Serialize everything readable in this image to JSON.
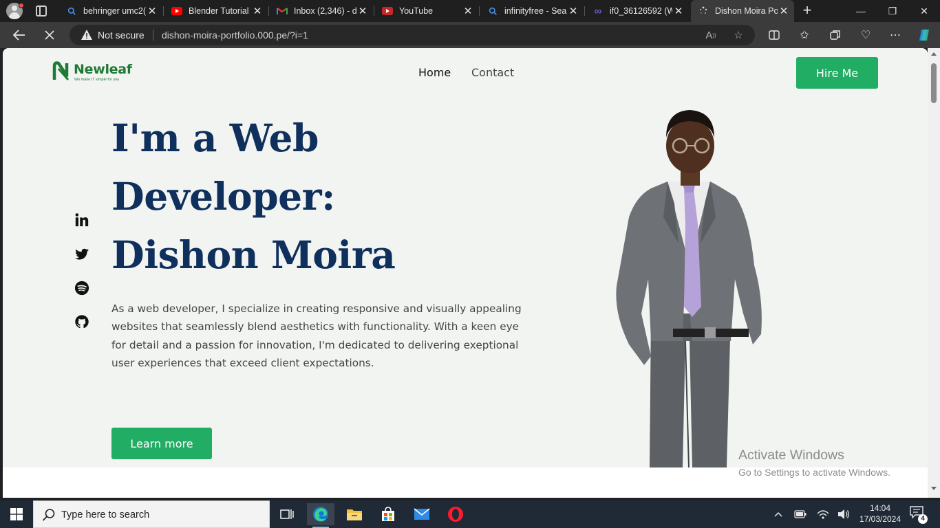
{
  "browser": {
    "tabs": [
      {
        "label": "behringer umc2(",
        "icon": "search-icon"
      },
      {
        "label": "Blender Tutorial",
        "icon": "youtube-icon"
      },
      {
        "label": "Inbox (2,346) - d",
        "icon": "gmail-icon"
      },
      {
        "label": "YouTube",
        "icon": "youtube-icon"
      },
      {
        "label": "infinityfree - Sea",
        "icon": "search-icon"
      },
      {
        "label": "if0_36126592 (W",
        "icon": "infinityfree-icon"
      },
      {
        "label": "Dishon Moira Po",
        "icon": "loading-icon",
        "active": true
      }
    ],
    "security_text": "Not secure",
    "url": "dishon-moira-portfolio.000.pe/?i=1"
  },
  "site": {
    "logo": {
      "name": "Newleaf",
      "tagline": "We make IT simple for you"
    },
    "nav": {
      "home": "Home",
      "contact": "Contact"
    },
    "hire_button": "Hire Me",
    "hero": {
      "title_lines": [
        "I'm a Web",
        "Developer:",
        "Dishon Moira"
      ],
      "description": "As a web developer, I specialize in creating responsive and visually appealing websites that seamlessly blend aesthetics with functionality. With a keen eye for detail and a passion for innovation, I'm dedicated to delivering exeptional user experiences that exceed client expectations.",
      "learn_button": "Learn more"
    },
    "socials": [
      "linkedin-icon",
      "twitter-icon",
      "spotify-icon",
      "github-icon"
    ]
  },
  "watermark": {
    "title": "Activate Windows",
    "subtitle": "Go to Settings to activate Windows."
  },
  "taskbar": {
    "search_placeholder": "Type here to search",
    "time": "14:04",
    "date": "17/03/2024",
    "notification_count": "4"
  },
  "colors": {
    "accent_green": "#21ad63",
    "title_navy": "#0f2f5c",
    "page_bg": "#f2f4f2"
  }
}
